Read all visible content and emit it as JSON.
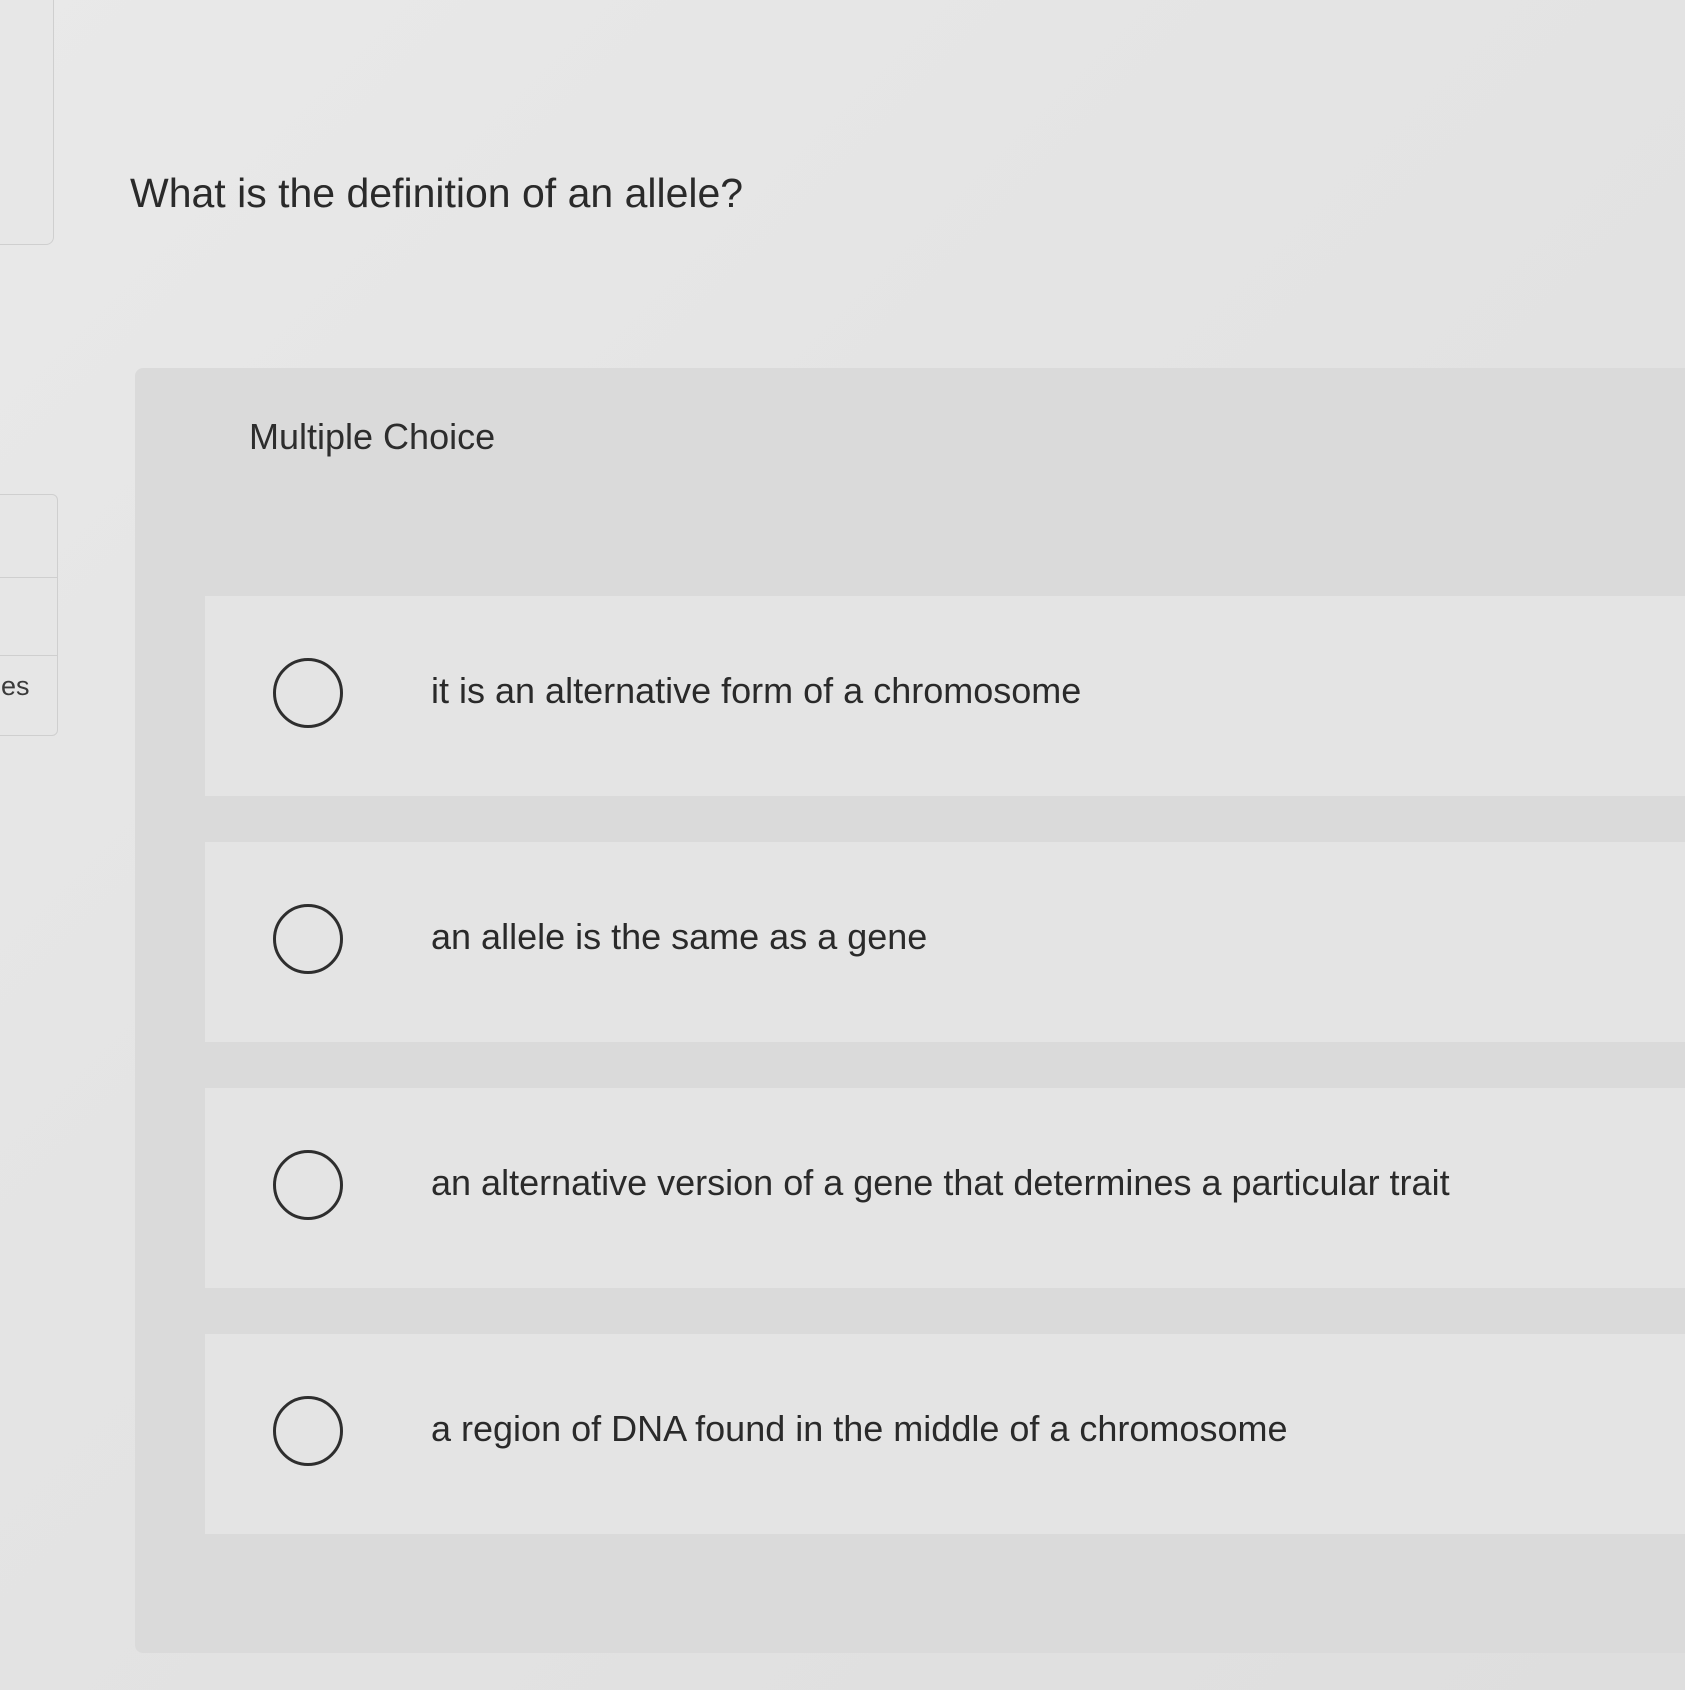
{
  "sidebar": {
    "nav_label": "es"
  },
  "question": {
    "title": "What is the definition of an allele?"
  },
  "multiple_choice": {
    "label": "Multiple Choice",
    "options": [
      {
        "text": "it is an alternative form of a chromosome",
        "selected": false
      },
      {
        "text": "an allele is the same as a gene",
        "selected": false
      },
      {
        "text": "an alternative version of a gene that determines a particular trait",
        "selected": false
      },
      {
        "text": "a region of DNA found in the middle of a chromosome",
        "selected": false
      }
    ]
  }
}
